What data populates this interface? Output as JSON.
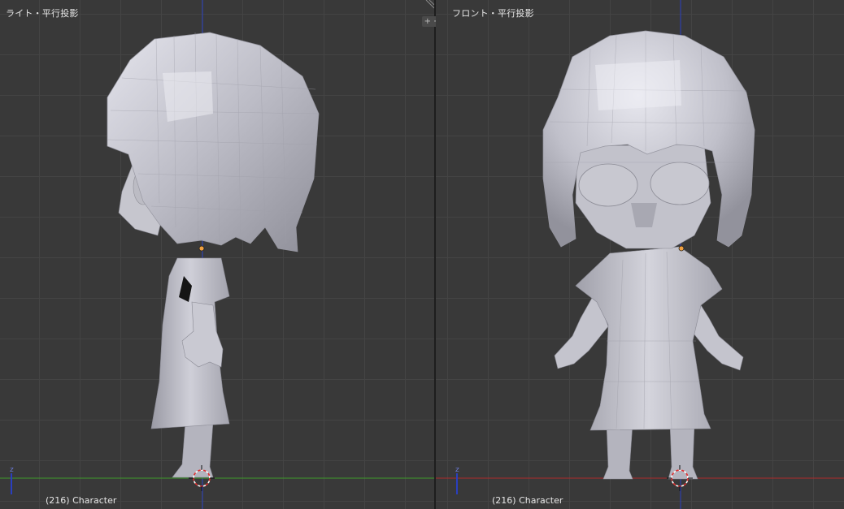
{
  "viewports": {
    "left": {
      "label": "ライト・平行投影",
      "frame_text": "(216) Character",
      "gizmo_axes": {
        "vertical": "z",
        "horizontal": "y"
      }
    },
    "right": {
      "label": "フロント・平行投影",
      "frame_text": "(216) Character",
      "gizmo_axes": {
        "vertical": "z",
        "horizontal": "x"
      }
    }
  },
  "colors": {
    "grid_bg": "#393939",
    "z_axis": "#2a3fbf",
    "y_axis": "#3f9a2a",
    "x_axis": "#b02a2a",
    "mesh_light": "#d8d8e0",
    "mesh_mid": "#b8b8c2",
    "mesh_shadow": "#8c8c96",
    "origin_dot": "#f0a040",
    "cursor_red": "#e03030"
  },
  "icons": [
    "split-area-icon",
    "corner-resize-icon",
    "axis-gizmo-icon",
    "3d-cursor-icon",
    "origin-point-icon"
  ]
}
